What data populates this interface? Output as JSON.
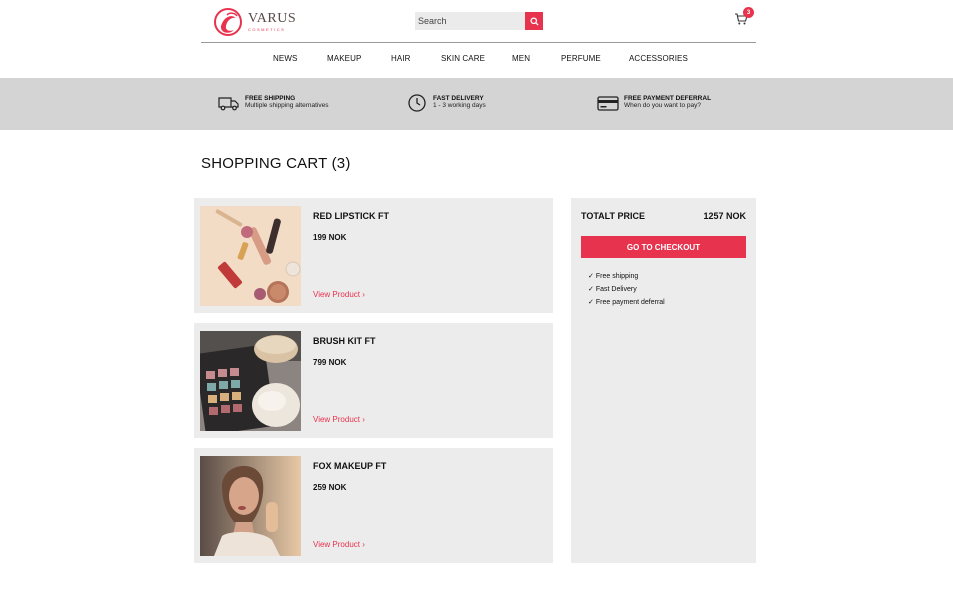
{
  "brand": {
    "name": "VARUS",
    "tagline": "COSMETICS"
  },
  "search": {
    "placeholder": "Search"
  },
  "cart": {
    "count": "3"
  },
  "nav": [
    "NEWS",
    "MAKEUP",
    "HAIR",
    "SKIN CARE",
    "MEN",
    "PERFUME",
    "ACCESSORIES"
  ],
  "features": [
    {
      "icon": "delivery-truck-icon",
      "title": "FREE SHIPPING",
      "subtitle": "Multiple shipping alternatives"
    },
    {
      "icon": "clock-icon",
      "title": "FAST DELIVERY",
      "subtitle": "1 - 3 working days"
    },
    {
      "icon": "credit-card-icon",
      "title": "FREE PAYMENT DEFERRAL",
      "subtitle": "When do you want to pay?"
    }
  ],
  "page_title": "SHOPPING CART (3)",
  "items": [
    {
      "name": "RED LIPSTICK FT",
      "price": "199 NOK",
      "link": "View Product ›",
      "image": "makeup-products-flatlay"
    },
    {
      "name": "BRUSH KIT FT",
      "price": "799 NOK",
      "link": "View Product ›",
      "image": "eyeshadow-palette-and-brushes"
    },
    {
      "name": "FOX MAKEUP FT",
      "price": "259 NOK",
      "link": "View Product ›",
      "image": "woman-portrait"
    }
  ],
  "summary": {
    "total_label": "TOTALT PRICE",
    "total_value": "1257 NOK",
    "checkout_label": "GO TO CHECKOUT",
    "perks": [
      "Free shipping",
      "Fast Delivery",
      "Free payment deferral"
    ]
  },
  "colors": {
    "accent": "#e8334f",
    "band": "#d4d4d4",
    "card": "#ececec"
  }
}
